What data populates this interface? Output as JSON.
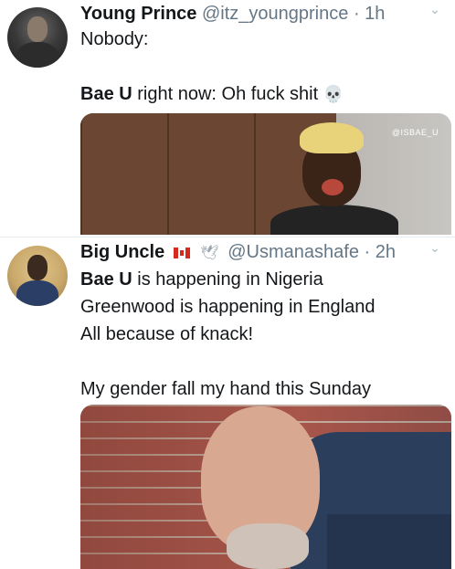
{
  "tweets": [
    {
      "display_name": "Young Prince",
      "handle": "@itz_youngprince",
      "separator": "·",
      "time": "1h",
      "caret_icon": "chevron-down-icon",
      "lines": [
        "Nobody:",
        "",
        ""
      ],
      "line2_bold": "Bae U",
      "line2_rest": " right now: Oh fuck shit",
      "emoji": "💀",
      "media": {
        "kind": "image",
        "watermark": "@ISBAE_U"
      }
    },
    {
      "display_name": "Big Uncle",
      "flag_icon": "canada-flag-icon",
      "dove_icon": "dove-icon",
      "dove_glyph": "🕊",
      "handle": "@Usmanashafe",
      "separator": "·",
      "time": "2h",
      "caret_icon": "chevron-down-icon",
      "line1_bold": "Bae U",
      "line1_rest": " is happening in Nigeria",
      "line2": "Greenwood is happening in England",
      "line3": "All because of knack!",
      "line5": "My gender fall my hand this Sunday",
      "media": {
        "kind": "image"
      }
    }
  ],
  "colors": {
    "text": "#14171a",
    "secondary": "#657786",
    "divider": "#e6ecf0"
  }
}
